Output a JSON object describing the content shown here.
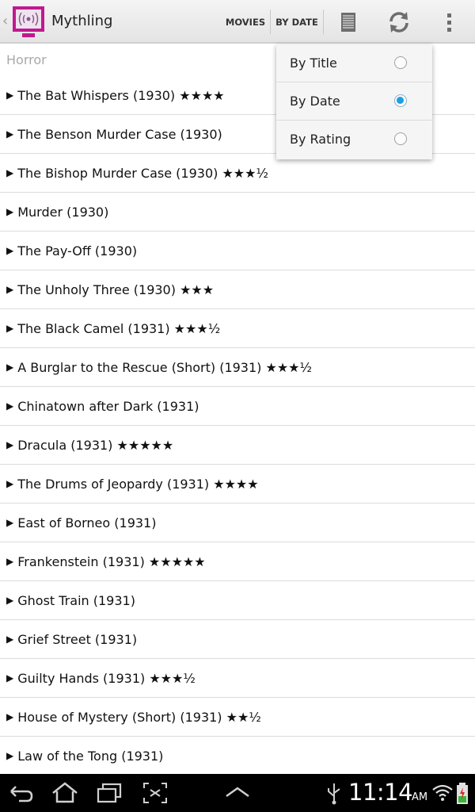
{
  "app": {
    "title": "Mythling",
    "icon": "tv-broadcast-logo",
    "up_indicator": "‹"
  },
  "actionbar": {
    "movies_label": "MOVIES",
    "sort_label": "BY DATE",
    "icons": [
      "list-view-icon",
      "refresh-icon",
      "overflow-menu-icon"
    ]
  },
  "section": {
    "header": "Horror"
  },
  "movies": [
    {
      "label": "The Bat Whispers (1930) ★★★★"
    },
    {
      "label": "The Benson Murder Case (1930)"
    },
    {
      "label": "The Bishop Murder Case (1930) ★★★½"
    },
    {
      "label": "Murder (1930)"
    },
    {
      "label": "The Pay-Off (1930)"
    },
    {
      "label": "The Unholy Three (1930) ★★★"
    },
    {
      "label": "The Black Camel (1931) ★★★½"
    },
    {
      "label": "A Burglar to the Rescue (Short) (1931) ★★★½"
    },
    {
      "label": "Chinatown after Dark (1931)"
    },
    {
      "label": "Dracula (1931) ★★★★★"
    },
    {
      "label": "The Drums of Jeopardy (1931) ★★★★"
    },
    {
      "label": "East of Borneo (1931)"
    },
    {
      "label": "Frankenstein (1931) ★★★★★"
    },
    {
      "label": "Ghost Train (1931)"
    },
    {
      "label": "Grief Street (1931)"
    },
    {
      "label": "Guilty Hands (1931) ★★★½"
    },
    {
      "label": "House of Mystery (Short) (1931) ★★½"
    },
    {
      "label": "Law of the Tong (1931)"
    }
  ],
  "sort_menu": {
    "options": [
      {
        "label": "By Title",
        "selected": false
      },
      {
        "label": "By Date",
        "selected": true
      },
      {
        "label": "By Rating",
        "selected": false
      }
    ]
  },
  "status": {
    "time": "11:14",
    "ampm": "AM",
    "icons": [
      "back-icon",
      "home-icon",
      "recent-apps-icon",
      "screenshot-icon",
      "up-chevron-icon",
      "usb-icon",
      "wifi-icon",
      "battery-icon"
    ]
  },
  "colors": {
    "accent": "#1e9ee0",
    "logo_magenta": "#c0198f",
    "navbar": "#000000"
  }
}
